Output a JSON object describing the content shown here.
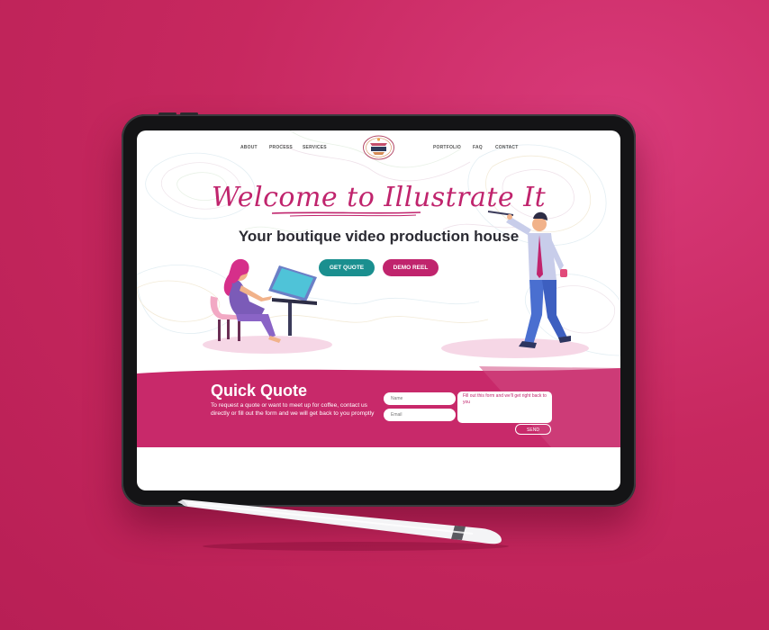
{
  "nav": {
    "left": [
      "ABOUT",
      "PROCESS",
      "SERVICES"
    ],
    "right": [
      "PORTFOLIO",
      "FAQ",
      "CONTACT"
    ],
    "logo_text": "illustrate it"
  },
  "hero": {
    "welcome": "Welcome to Illustrate It",
    "tagline": "Your boutique video production house",
    "buttons": {
      "quote": "GET QUOTE",
      "reel": "DEMO REEL"
    }
  },
  "quick_quote": {
    "title": "Quick Quote",
    "text": "To request a quote or want to meet up for coffee, contact us directly or fill out the form and we will get back to you promptly",
    "name_placeholder": "Name",
    "email_placeholder": "Email",
    "message_placeholder": "Fill out this form and we'll get right back to you",
    "send_label": "SEND"
  },
  "colors": {
    "brand_pink": "#c0246d",
    "brand_teal": "#1a8f8f",
    "background": "#c7285f"
  }
}
